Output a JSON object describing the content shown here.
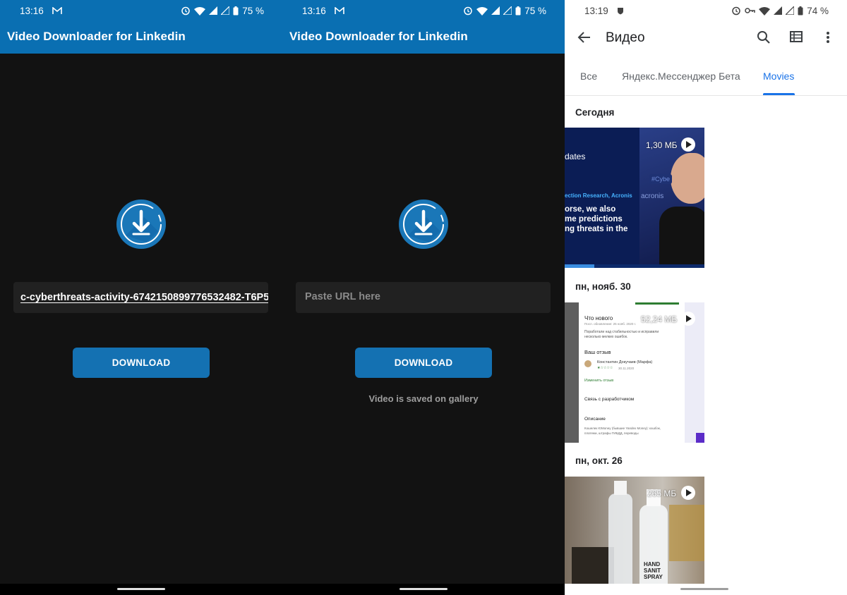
{
  "colors": {
    "accent": "#0a6fb2",
    "button": "#1471b2",
    "dark_bg": "#121212",
    "tab_active": "#1a73e8"
  },
  "screen1": {
    "status": {
      "time": "13:16",
      "battery": "75 %"
    },
    "app_title": "Video Downloader for Linkedin",
    "url_value": "c-cyberthreats-activity-6742150899776532482-T6P5",
    "download_label": "DOWNLOAD"
  },
  "screen2": {
    "status": {
      "time": "13:16",
      "battery": "75 %"
    },
    "app_title": "Video Downloader for Linkedin",
    "url_placeholder": "Paste URL here",
    "download_label": "DOWNLOAD",
    "saved_message": "Video is saved on gallery"
  },
  "screen3": {
    "status": {
      "time": "13:19",
      "battery": "74 %"
    },
    "title": "Видео",
    "tabs": [
      {
        "label": "Все",
        "active": false
      },
      {
        "label": "Яндекс.Мессенджер Бета",
        "active": false
      },
      {
        "label": "Movies",
        "active": true
      }
    ],
    "groups": [
      {
        "date": "Сегодня",
        "video": {
          "size": "1,30 МБ",
          "lines": [
            "dates",
            "ection Research, Acronis",
            "orse, we also",
            "me predictions",
            "ng threats in the"
          ],
          "tags": [
            "#Cybe",
            "acronis"
          ]
        }
      },
      {
        "date": "пн, нояб. 30",
        "video": {
          "size": "52,24 МБ",
          "lines": [
            "Что нового",
            "Посл. обновление: 25 нояб. 2020 г.",
            "Поработали над стабильностью и исправили",
            "несколько мелких ошибок.",
            "Ваш отзыв",
            "Константин Докучаев (Марфа)",
            "30.11.2020",
            "Изменить отзыв",
            "Связь с разработчиком",
            "Описание",
            "Кошелек ЮMoney (бывшие Yandex Money): кэшбэк,",
            "платежи, штрафы ГИБДД, переводы"
          ]
        }
      },
      {
        "date": "пн, окт. 26",
        "video": {
          "size": "265 МБ",
          "label_text": [
            "HAND",
            "SANIT",
            "SPRAY"
          ]
        }
      }
    ]
  }
}
